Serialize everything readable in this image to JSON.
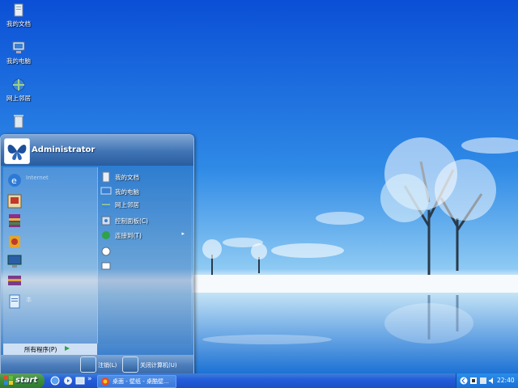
{
  "desktop": {
    "icons": [
      {
        "label": "我的文档",
        "icon": "my-documents-icon"
      },
      {
        "label": "我的电脑",
        "icon": "my-computer-icon"
      },
      {
        "label": "网上邻居",
        "icon": "network-places-icon"
      },
      {
        "label": "",
        "icon": "recycle-bin-icon"
      }
    ]
  },
  "start_menu": {
    "user": "Administrator",
    "pinned": [
      {
        "label": "Internet",
        "icon": "internet-explorer-icon"
      },
      {
        "label": "",
        "icon": "photo-app-icon"
      },
      {
        "label": "",
        "icon": "winrar-icon"
      },
      {
        "label": "",
        "icon": "media-icon"
      },
      {
        "label": "",
        "icon": "monitor-icon"
      },
      {
        "label": "",
        "icon": "archive-icon"
      },
      {
        "label": "本",
        "icon": "notepad-icon"
      }
    ],
    "places": [
      {
        "label": "我的文档",
        "icon": "my-documents-icon"
      },
      {
        "label": "我的电脑",
        "icon": "my-computer-icon"
      },
      {
        "label": "网上邻居",
        "icon": "network-places-icon"
      },
      {
        "label": "控制面板(C)",
        "icon": "control-panel-icon"
      },
      {
        "label": "连接到(T)",
        "icon": "connect-to-icon",
        "arrow": "▸"
      },
      {
        "label": "",
        "icon": "help-icon"
      },
      {
        "label": "",
        "icon": "search-icon"
      }
    ],
    "all_programs": "所有程序(P)",
    "logoff": "注销(L)",
    "shutdown": "关闭计算机(U)"
  },
  "taskbar": {
    "start_label": "start",
    "overflow": "»",
    "task": "桌面 - 壁纸 - 桌酷壁...",
    "clock": "22:40"
  },
  "colors": {
    "sky_top": "#0a52d8",
    "sky_bottom": "#7fc3f2",
    "taskbar": "#245edb",
    "start_green": "#3a8c3a"
  }
}
